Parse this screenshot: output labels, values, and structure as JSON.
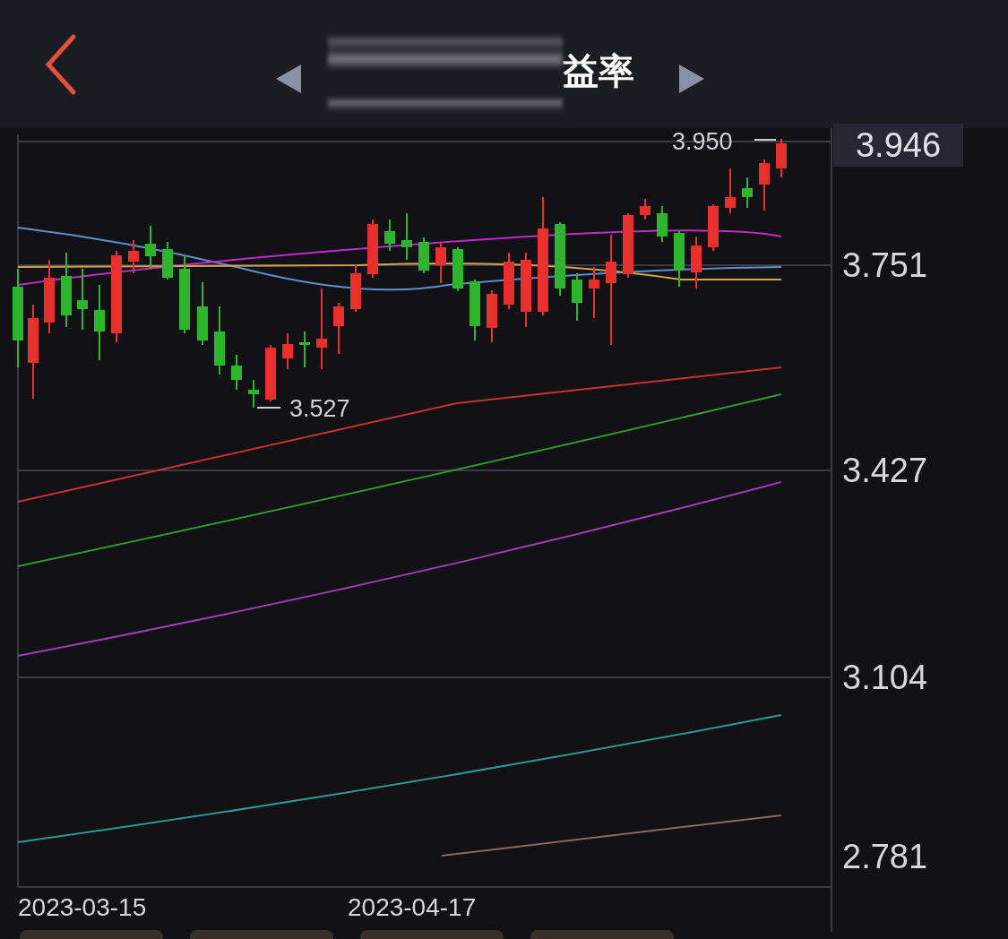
{
  "header": {
    "title": "益率"
  },
  "y_axis": {
    "current": "3.946",
    "labels": [
      "3.751",
      "3.427",
      "3.104",
      "2.781"
    ]
  },
  "annotations": {
    "high": "3.950",
    "low": "3.527"
  },
  "x_axis": {
    "labels": [
      "2023-03-15",
      "2023-04-17"
    ]
  }
}
